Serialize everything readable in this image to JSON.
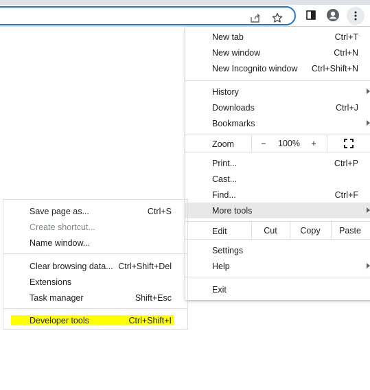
{
  "toolbar": {
    "icons": [
      "share-icon",
      "star-icon",
      "side-panel-icon",
      "profile-icon",
      "kebab-menu-icon"
    ]
  },
  "main_menu": {
    "new_tab": {
      "label": "New tab",
      "shortcut": "Ctrl+T"
    },
    "new_window": {
      "label": "New window",
      "shortcut": "Ctrl+N"
    },
    "new_incognito": {
      "label": "New Incognito window",
      "shortcut": "Ctrl+Shift+N"
    },
    "history": {
      "label": "History"
    },
    "downloads": {
      "label": "Downloads",
      "shortcut": "Ctrl+J"
    },
    "bookmarks": {
      "label": "Bookmarks"
    },
    "zoom": {
      "label": "Zoom",
      "minus": "−",
      "value": "100%",
      "plus": "+"
    },
    "print": {
      "label": "Print...",
      "shortcut": "Ctrl+P"
    },
    "cast": {
      "label": "Cast..."
    },
    "find": {
      "label": "Find...",
      "shortcut": "Ctrl+F"
    },
    "more_tools": {
      "label": "More tools"
    },
    "edit": {
      "label": "Edit",
      "cut": "Cut",
      "copy": "Copy",
      "paste": "Paste"
    },
    "settings": {
      "label": "Settings"
    },
    "help": {
      "label": "Help"
    },
    "exit": {
      "label": "Exit"
    }
  },
  "sub_menu": {
    "save_page": {
      "label": "Save page as...",
      "shortcut": "Ctrl+S"
    },
    "create_shortcut": {
      "label": "Create shortcut..."
    },
    "name_window": {
      "label": "Name window..."
    },
    "clear_data": {
      "label": "Clear browsing data...",
      "shortcut": "Ctrl+Shift+Del"
    },
    "extensions": {
      "label": "Extensions"
    },
    "task_manager": {
      "label": "Task manager",
      "shortcut": "Shift+Esc"
    },
    "developer_tools": {
      "label": "Developer tools",
      "shortcut": "Ctrl+Shift+I"
    }
  },
  "colors": {
    "accent": "#1a73e8",
    "hover": "#e8e8e9",
    "highlight": "#ffff00",
    "separator": "#dadce0"
  }
}
